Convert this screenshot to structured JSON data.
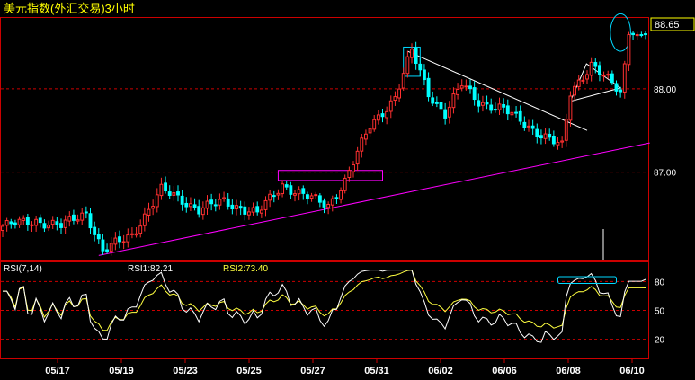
{
  "chart_data": [
    {
      "type": "candlestick",
      "title": "美元指数(外汇交易)3小时",
      "last_price": "88.65",
      "y_ticks": [
        {
          "label": "88.00",
          "value": 88.0
        },
        {
          "label": "87.00",
          "value": 87.0
        }
      ],
      "ylim": [
        85.95,
        88.85
      ],
      "x_ticks": [
        "05/17",
        "05/19",
        "05/23",
        "05/25",
        "05/27",
        "05/31",
        "06/02",
        "06/06",
        "06/08",
        "06/10"
      ],
      "colors": {
        "up": "#ff3030",
        "down": "#00ffff",
        "trendline": "#ff00ff",
        "channel": "#ffffff",
        "grid": "#cc0000",
        "price_box": "#ffff00"
      },
      "bar_count": 155,
      "anchors": [
        {
          "bar": 0,
          "close": 86.35
        },
        {
          "bar": 8,
          "close": 86.42
        },
        {
          "bar": 14,
          "close": 86.35
        },
        {
          "bar": 20,
          "close": 86.52
        },
        {
          "bar": 24,
          "close": 86.05
        },
        {
          "bar": 31,
          "close": 86.25
        },
        {
          "bar": 38,
          "close": 86.78
        },
        {
          "bar": 42,
          "close": 86.7
        },
        {
          "bar": 47,
          "close": 86.55
        },
        {
          "bar": 53,
          "close": 86.65
        },
        {
          "bar": 61,
          "close": 86.5
        },
        {
          "bar": 67,
          "close": 86.85
        },
        {
          "bar": 73,
          "close": 86.7
        },
        {
          "bar": 78,
          "close": 86.6
        },
        {
          "bar": 82,
          "close": 86.9
        },
        {
          "bar": 88,
          "close": 87.55
        },
        {
          "bar": 94,
          "close": 87.9
        },
        {
          "bar": 98,
          "close": 88.45
        },
        {
          "bar": 102,
          "close": 87.95
        },
        {
          "bar": 106,
          "close": 87.7
        },
        {
          "bar": 110,
          "close": 88.05
        },
        {
          "bar": 114,
          "close": 87.85
        },
        {
          "bar": 120,
          "close": 87.75
        },
        {
          "bar": 126,
          "close": 87.55
        },
        {
          "bar": 134,
          "close": 87.3
        },
        {
          "bar": 136,
          "close": 87.95
        },
        {
          "bar": 141,
          "close": 88.3
        },
        {
          "bar": 148,
          "close": 87.95
        },
        {
          "bar": 149,
          "close": 88.3
        },
        {
          "bar": 150,
          "close": 88.65
        }
      ],
      "annotations": [
        {
          "kind": "trendline",
          "color": "magenta",
          "from": {
            "bar": 23,
            "price": 86.0
          },
          "to": {
            "bar": 155,
            "price": 87.35
          }
        },
        {
          "kind": "trendline",
          "color": "white",
          "from": {
            "bar": 97,
            "price": 88.45
          },
          "to": {
            "bar": 140,
            "price": 87.5
          }
        },
        {
          "kind": "box",
          "color": "magenta",
          "bars": [
            66,
            91
          ],
          "prices": [
            86.9,
            87.02
          ]
        },
        {
          "kind": "box",
          "color": "cyan",
          "bars": [
            96,
            100
          ],
          "prices": [
            88.15,
            88.5
          ]
        },
        {
          "kind": "ellipse",
          "color": "cyan",
          "bars": [
            146,
            150
          ],
          "prices": [
            88.45,
            88.9
          ]
        },
        {
          "kind": "triangle",
          "color": "white",
          "bars": [
            136,
            148
          ],
          "prices": [
            87.85,
            88.3
          ]
        }
      ]
    },
    {
      "type": "line",
      "title": "RSI(7,14)",
      "series": [
        {
          "name": "RSI1",
          "label": "RSI1:82.21",
          "color": "#ffffff",
          "last": 82.21
        },
        {
          "name": "RSI2",
          "label": "RSI2:73.40",
          "color": "#ffff40",
          "last": 73.4
        }
      ],
      "y_ticks": [
        80,
        50,
        20
      ],
      "ylim": [
        0,
        100
      ],
      "annotations": [
        {
          "kind": "box",
          "color": "cyan",
          "bars": [
            133,
            147
          ],
          "values": [
            78,
            85
          ]
        }
      ]
    }
  ]
}
